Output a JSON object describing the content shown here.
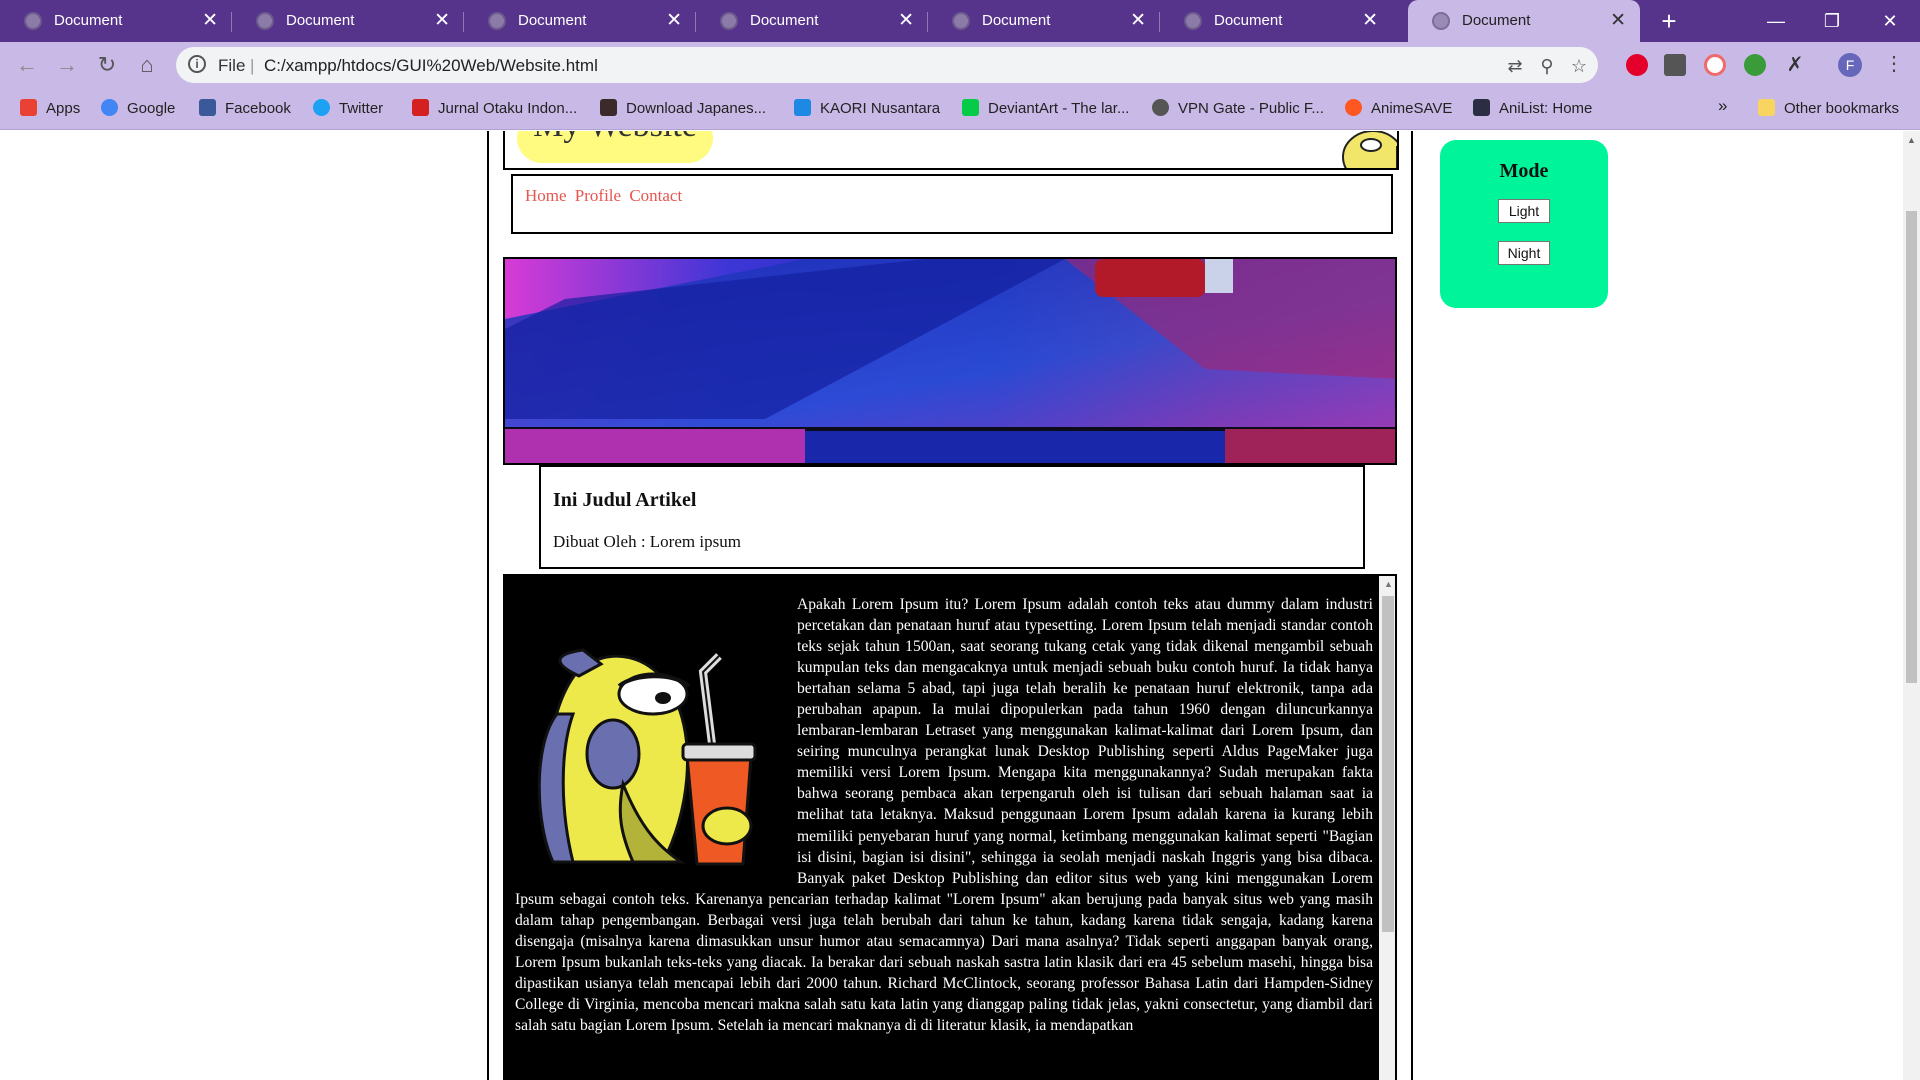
{
  "browser": {
    "tabs": [
      {
        "title": "Document",
        "active": false
      },
      {
        "title": "Document",
        "active": false
      },
      {
        "title": "Document",
        "active": false
      },
      {
        "title": "Document",
        "active": false
      },
      {
        "title": "Document",
        "active": false
      },
      {
        "title": "Document",
        "active": false
      },
      {
        "title": "Document",
        "active": true
      }
    ],
    "new_tab_glyph": "+",
    "window_controls": {
      "minimize": "—",
      "restore": "❐",
      "close": "✕"
    },
    "address": {
      "scheme": "File",
      "separator": "|",
      "url": "C:/xampp/htdocs/GUI%20Web/Website.html"
    },
    "profile_initial": "F",
    "bookmarks": [
      {
        "label": "Apps",
        "icon": "apps-icon",
        "color": "#e94235"
      },
      {
        "label": "Google",
        "icon": "google-icon",
        "color": "#4285f4"
      },
      {
        "label": "Facebook",
        "icon": "facebook-icon",
        "color": "#3b5998"
      },
      {
        "label": "Twitter",
        "icon": "twitter-icon",
        "color": "#1da1f2"
      },
      {
        "label": "Jurnal Otaku Indon...",
        "icon": "jurnal-otaku-icon",
        "color": "#d42020"
      },
      {
        "label": "Download Japanes...",
        "icon": "download-japanese-icon",
        "color": "#3a2a2a"
      },
      {
        "label": "KAORI Nusantara",
        "icon": "kaori-icon",
        "color": "#1e88e5"
      },
      {
        "label": "DeviantArt - The lar...",
        "icon": "deviantart-icon",
        "color": "#05cc47"
      },
      {
        "label": "VPN Gate - Public F...",
        "icon": "vpngate-icon",
        "color": "#555555"
      },
      {
        "label": "AnimeSAVE",
        "icon": "animesave-icon",
        "color": "#ff5722"
      },
      {
        "label": "AniList: Home",
        "icon": "anilist-icon",
        "color": "#2b2d42"
      }
    ],
    "overflow_glyph": "»",
    "other_bookmarks": "Other bookmarks"
  },
  "page": {
    "site_title": "My Website",
    "nav": [
      "Home",
      "Profile",
      "Contact"
    ],
    "article": {
      "title": "Ini Judul Artikel",
      "author": "Dibuat Oleh : Lorem ipsum",
      "body": "Apakah Lorem Ipsum itu? Lorem Ipsum adalah contoh teks atau dummy dalam industri percetakan dan penataan huruf atau typesetting. Lorem Ipsum telah menjadi standar contoh teks sejak tahun 1500an, saat seorang tukang cetak yang tidak dikenal mengambil sebuah kumpulan teks dan mengacaknya untuk menjadi sebuah buku contoh huruf. Ia tidak hanya bertahan selama 5 abad, tapi juga telah beralih ke penataan huruf elektronik, tanpa ada perubahan apapun. Ia mulai dipopulerkan pada tahun 1960 dengan diluncurkannya lembaran-lembaran Letraset yang menggunakan kalimat-kalimat dari Lorem Ipsum, dan seiring munculnya perangkat lunak Desktop Publishing seperti Aldus PageMaker juga memiliki versi Lorem Ipsum. Mengapa kita menggunakannya? Sudah merupakan fakta bahwa seorang pembaca akan terpengaruh oleh isi tulisan dari sebuah halaman saat ia melihat tata letaknya. Maksud penggunaan Lorem Ipsum adalah karena ia kurang lebih memiliki penyebaran huruf yang normal, ketimbang menggunakan kalimat seperti \"Bagian isi disini, bagian isi disini\", sehingga ia seolah menjadi naskah Inggris yang bisa dibaca. Banyak paket Desktop Publishing dan editor situs web yang kini menggunakan Lorem Ipsum sebagai contoh teks. Karenanya pencarian terhadap kalimat \"Lorem Ipsum\" akan berujung pada banyak situs web yang masih dalam tahap pengembangan. Berbagai versi juga telah berubah dari tahun ke tahun, kadang karena tidak sengaja, kadang karena disengaja (misalnya karena dimasukkan unsur humor atau semacamnya) Dari mana asalnya? Tidak seperti anggapan banyak orang, Lorem Ipsum bukanlah teks-teks yang diacak. Ia berakar dari sebuah naskah sastra latin klasik dari era 45 sebelum masehi, hingga bisa dipastikan usianya telah mencapai lebih dari 2000 tahun. Richard McClintock, seorang professor Bahasa Latin dari Hampden-Sidney College di Virginia, mencoba mencari makna salah satu kata latin yang dianggap paling tidak jelas, yakni consectetur, yang diambil dari salah satu bagian Lorem Ipsum. Setelah ia mencari maknanya di di literatur klasik, ia mendapatkan"
    },
    "mode_panel": {
      "title": "Mode",
      "light_label": "Light",
      "night_label": "Night"
    },
    "colors": {
      "mode_panel_bg": "#00f59a",
      "nav_link": "#e8554e",
      "title_highlight": "#fffa80",
      "tab_strip": "#56348c",
      "toolbar": "#c9b9e6"
    }
  }
}
